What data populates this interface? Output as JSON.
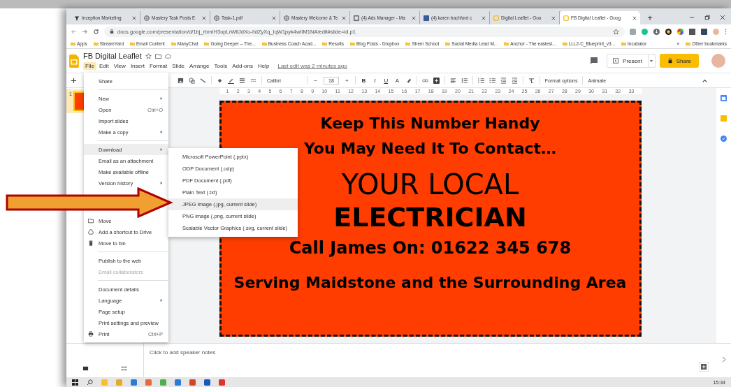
{
  "browser": {
    "tabs": [
      {
        "label": "Inception Marketing",
        "selected": false
      },
      {
        "label": "Mastery Task Posts E",
        "selected": false
      },
      {
        "label": "Task-1.pdf",
        "selected": false
      },
      {
        "label": "Mastery Welcome & Te",
        "selected": false
      },
      {
        "label": "(4) Ads Manager - Ma",
        "selected": false
      },
      {
        "label": "(4) karen bachford c",
        "selected": false
      },
      {
        "label": "Digital Leaflet - Goo",
        "selected": false
      },
      {
        "label": "FB Digital Leaflet - Goog",
        "selected": true
      }
    ],
    "new_tab": "+",
    "url": "docs.google.com/presentation/d/1bj_rbmIH3opLrWtlJdXo-/tdZyXq_IqW1pyk4wIIM1NA/edit#slide=id.p1",
    "bookmarks": [
      "Apps",
      "StreamYard",
      "Email Content",
      "ManyChat",
      "Going Deeper – The...",
      "Business Coach Acad...",
      "Results",
      "Blog Posts - Dropbox",
      "Shem School",
      "Social Media Lead M...",
      "Anchor - The easiest...",
      "LLL2-C_Blueprint_v3...",
      "Incubator"
    ],
    "more": "»",
    "other_bookmarks": "Other bookmarks"
  },
  "app": {
    "title": "FB Digital Leaflet",
    "menus": [
      {
        "label": "File",
        "selected": true
      },
      {
        "label": "Edit",
        "selected": false
      },
      {
        "label": "View",
        "selected": false
      },
      {
        "label": "Insert",
        "selected": false
      },
      {
        "label": "Format",
        "selected": false
      },
      {
        "label": "Slide",
        "selected": false
      },
      {
        "label": "Arrange",
        "selected": false
      },
      {
        "label": "Tools",
        "selected": false
      },
      {
        "label": "Add-ons",
        "selected": false
      },
      {
        "label": "Help",
        "selected": false
      }
    ],
    "last_edit": "Last edit was 2 minutes ago",
    "present": "Present",
    "share": "Share"
  },
  "toolbar": {
    "font": "Calibri",
    "minus": "−",
    "size": "18",
    "plus": "+",
    "format_letters": [
      "B",
      "I",
      "U",
      "A"
    ],
    "format_options": "Format options",
    "animate": "Animate"
  },
  "ruler": [
    "1",
    "2",
    "3",
    "4",
    "5",
    "6",
    "7",
    "8",
    "9",
    "10",
    "11",
    "12",
    "13",
    "14",
    "15",
    "16",
    "17",
    "18",
    "19",
    "20",
    "21",
    "22",
    "23",
    "24",
    "25",
    "26",
    "27",
    "28",
    "29",
    "30",
    "31",
    "32",
    "33"
  ],
  "filmstrip": [
    {
      "number": "1",
      "selected": true
    }
  ],
  "slide": {
    "lines": [
      {
        "text": "Keep This Number Handy",
        "kind": "heading"
      },
      {
        "text": "You May Need It To Contact…",
        "kind": "heading"
      },
      {
        "text": "YOUR LOCAL",
        "kind": "large"
      },
      {
        "text": "ELECTRICIAN",
        "kind": "huge"
      },
      {
        "text": "Call James On: 01622 345 678",
        "kind": "phone"
      },
      {
        "text": "Serving Maidstone and the Surrounding Area",
        "kind": "heading"
      }
    ]
  },
  "file_menu": [
    {
      "kind": "plain",
      "label": "Share",
      "disabled": false,
      "selected": false
    },
    {
      "kind": "divider"
    },
    {
      "kind": "plain",
      "label": "New",
      "submenu": true,
      "disabled": false,
      "selected": false
    },
    {
      "kind": "plain",
      "label": "Open",
      "shortcut": "Ctrl+O",
      "disabled": false,
      "selected": false
    },
    {
      "kind": "plain",
      "label": "Import slides",
      "disabled": false,
      "selected": false
    },
    {
      "kind": "plain",
      "label": "Make a copy",
      "submenu": true,
      "disabled": false,
      "selected": false
    },
    {
      "kind": "divider"
    },
    {
      "kind": "plain",
      "label": "Download",
      "submenu": true,
      "disabled": false,
      "selected": true
    },
    {
      "kind": "plain",
      "label": "Email as an attachment",
      "disabled": false,
      "selected": false
    },
    {
      "kind": "plain",
      "label": "Make available offline",
      "disabled": false,
      "selected": false
    },
    {
      "kind": "plain",
      "label": "Version history",
      "submenu": true,
      "disabled": false,
      "selected": false
    },
    {
      "kind": "folder",
      "label": "Move",
      "disabled": false,
      "selected": false
    },
    {
      "kind": "drive",
      "label": "Add a shortcut to Drive",
      "disabled": false,
      "selected": false
    },
    {
      "kind": "bin",
      "label": "Move to bin",
      "disabled": false,
      "selected": false
    },
    {
      "kind": "divider"
    },
    {
      "kind": "plain",
      "label": "Publish to the web",
      "disabled": false,
      "selected": false
    },
    {
      "kind": "plain",
      "label": "Email collaborators",
      "disabled": true,
      "selected": false
    },
    {
      "kind": "divider"
    },
    {
      "kind": "plain",
      "label": "Document details",
      "disabled": false,
      "selected": false
    },
    {
      "kind": "plain",
      "label": "Language",
      "submenu": true,
      "disabled": false,
      "selected": false
    },
    {
      "kind": "plain",
      "label": "Page setup",
      "disabled": false,
      "selected": false
    },
    {
      "kind": "plain",
      "label": "Print settings and preview",
      "disabled": false,
      "selected": false
    },
    {
      "kind": "print",
      "label": "Print",
      "shortcut": "Ctrl+P",
      "disabled": false,
      "selected": false
    }
  ],
  "download_menu": [
    {
      "label": "Microsoft PowerPoint (.pptx)",
      "selected": false
    },
    {
      "label": "ODP Document (.odp)",
      "selected": false
    },
    {
      "label": "PDF Document (.pdf)",
      "selected": false
    },
    {
      "label": "Plain Text (.txt)",
      "selected": false
    },
    {
      "label": "JPEG image (.jpg, current slide)",
      "selected": true
    },
    {
      "label": "PNG image (.png, current slide)",
      "selected": false
    },
    {
      "label": "Scalable Vector Graphics (.svg, current slide)",
      "selected": false
    }
  ],
  "speaker_notes": {
    "placeholder": "Click to add speaker notes"
  },
  "taskbar": {
    "time": "15:34"
  }
}
